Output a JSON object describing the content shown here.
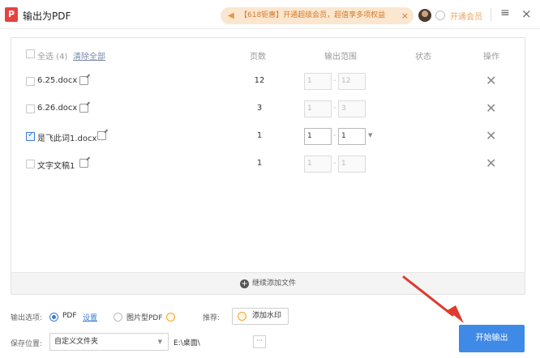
{
  "window": {
    "app_icon_letter": "P",
    "title": "输出为PDF",
    "promo_text": "【618钜惠】开通超级会员，超值享多项权益",
    "vip_link": "开通会员",
    "menu_glyph": "≡",
    "close_glyph": "×"
  },
  "table": {
    "header": {
      "select_all": "全选 (4)",
      "clear_all": "清除全部",
      "pages": "页数",
      "range": "输出范围",
      "status": "状态",
      "action": "操作"
    },
    "rows": [
      {
        "name": "6.25.docx",
        "checked": false,
        "pages": "12",
        "from": "1",
        "to": "12",
        "active": false
      },
      {
        "name": "6.26.docx",
        "checked": false,
        "pages": "3",
        "from": "1",
        "to": "3",
        "active": false
      },
      {
        "name": "是飞此词1.docx",
        "checked": true,
        "pages": "1",
        "from": "1",
        "to": "1",
        "active": true
      },
      {
        "name": "文字文稿1",
        "checked": false,
        "pages": "1",
        "from": "1",
        "to": "1",
        "active": false
      }
    ],
    "range_separator": "-",
    "delete_glyph": "✕",
    "add_more": "继续添加文件"
  },
  "options": {
    "output_label": "输出选项:",
    "pdf_option": "PDF",
    "pdf_settings": "设置",
    "image_pdf_option": "图片型PDF",
    "recommend_label": "推荐:",
    "watermark_button": "添加水印",
    "save_label": "保存位置:",
    "save_mode": "自定义文件夹",
    "save_path": "E:\\桌面\\",
    "browse_glyph": "···",
    "start_button": "开始输出"
  },
  "colors": {
    "accent": "#3e8ae6",
    "annotation_arrow": "#e03a2e",
    "promo_bg": "#fbe6cf"
  }
}
